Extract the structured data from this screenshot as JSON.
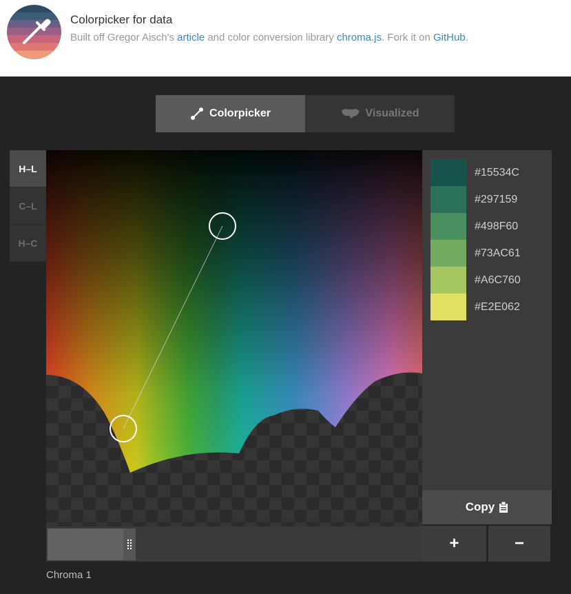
{
  "header": {
    "title": "Colorpicker for data",
    "subtitle_prefix": "Built off Gregor Aisch's ",
    "link_article": "article",
    "subtitle_middle": " and color conversion library ",
    "link_chroma": "chroma.js",
    "subtitle_fork": ". Fork it on ",
    "link_github": "GitHub",
    "subtitle_end": "."
  },
  "mode_tabs": [
    {
      "label": "Colorpicker",
      "icon": "pen-curve-icon",
      "active": true
    },
    {
      "label": "Visualized",
      "icon": "us-map-icon",
      "active": false
    }
  ],
  "space_tabs": [
    {
      "label": "H–L",
      "active": true
    },
    {
      "label": "C–L",
      "active": false
    },
    {
      "label": "H–C",
      "active": false
    }
  ],
  "palette": [
    {
      "hex": "#15534C",
      "color": "#15534C"
    },
    {
      "hex": "#297159",
      "color": "#297159"
    },
    {
      "hex": "#498F60",
      "color": "#498F60"
    },
    {
      "hex": "#73AC61",
      "color": "#73AC61"
    },
    {
      "hex": "#A6C760",
      "color": "#A6C760"
    },
    {
      "hex": "#E2E062",
      "color": "#E2E062"
    }
  ],
  "buttons": {
    "copy": "Copy",
    "plus": "+",
    "minus": "−"
  },
  "slider": {
    "label": "Chroma 1"
  },
  "colors": {
    "background": "#232323",
    "link": "#3f87b4",
    "active_tab": "#5a5a5a",
    "inactive_tab": "#353535"
  }
}
